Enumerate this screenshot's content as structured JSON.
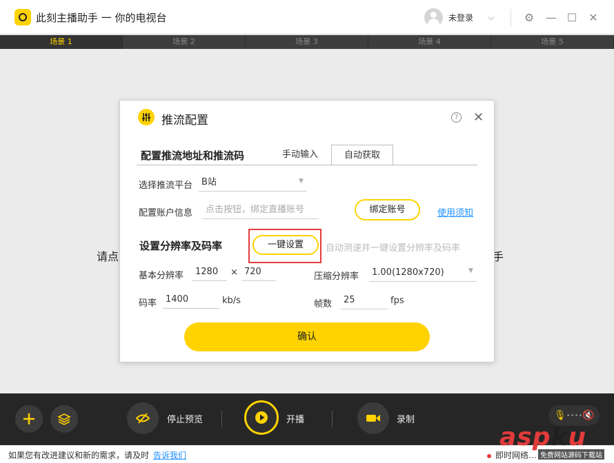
{
  "app": {
    "title": "此刻主播助手 一 你的电视台",
    "login_status": "未登录"
  },
  "scenes": [
    "场景 1",
    "场景 2",
    "场景 3",
    "场景 4",
    "场景 5"
  ],
  "background": {
    "left_text": "请点",
    "right_text": "手"
  },
  "dialog": {
    "title": "推流配置",
    "section1_title": "配置推流地址和推流码",
    "tabs": [
      "手动输入",
      "自动获取"
    ],
    "platform_label": "选择推流平台",
    "platform_value": "B站",
    "account_label": "配置账户信息",
    "account_placeholder": "点击按钮，绑定直播账号",
    "bind_button": "绑定账号",
    "usage_link": "使用须知",
    "section2_title": "设置分辨率及码率",
    "one_key_button": "一键设置",
    "one_key_hint": "自动测速并一键设置分辨率及码率",
    "base_res_label": "基本分辨率",
    "base_res_w": "1280",
    "times": "×",
    "base_res_h": "720",
    "compress_label": "压缩分辨率",
    "compress_value": "1.00(1280x720)",
    "bitrate_label": "码率",
    "bitrate_value": "1400",
    "bitrate_unit": "kb/s",
    "fps_label": "帧数",
    "fps_value": "25",
    "fps_unit": "fps",
    "confirm": "确认"
  },
  "toolbar": {
    "stop_preview": "停止预览",
    "start": "开播",
    "record": "录制"
  },
  "status": {
    "message": "如果您有改进建议和新的需求，请及时",
    "tell_us": "告诉我们",
    "network": "即时网络…"
  },
  "watermark": {
    "text_a": "asp",
    "text_k": "k",
    "text_b": "u",
    "sub": "免费网站源码下载站"
  },
  "colors": {
    "accent": "#ffd200",
    "highlight": "#e23b3b",
    "link": "#1e90ff"
  }
}
